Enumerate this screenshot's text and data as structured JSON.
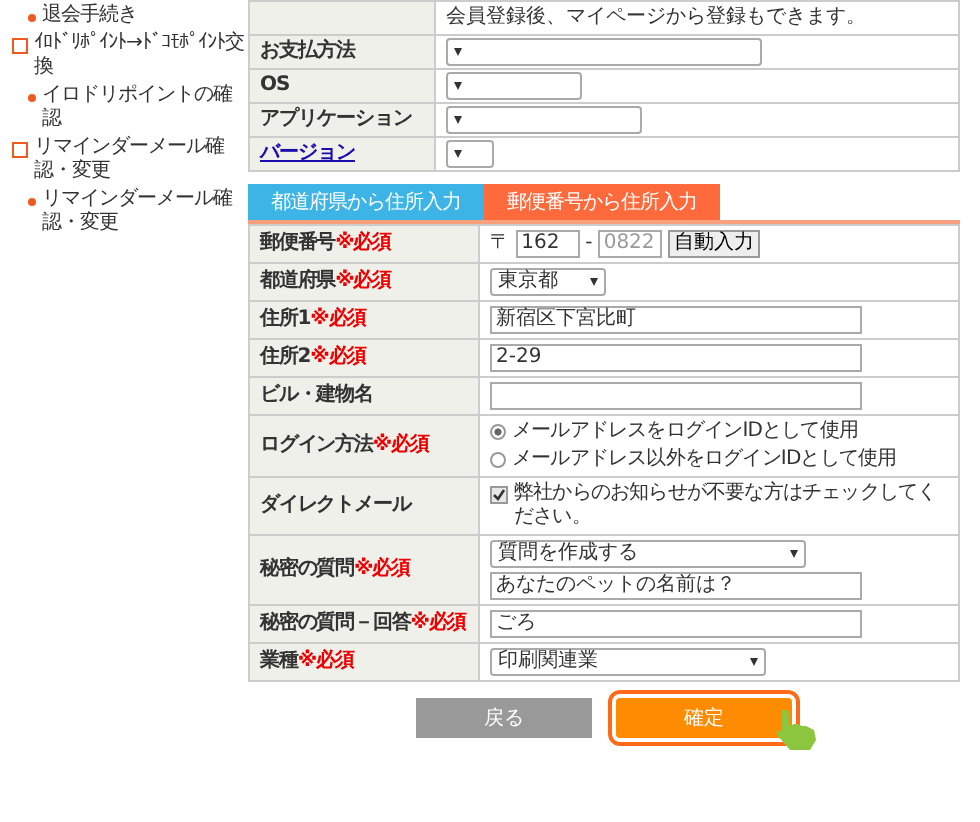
{
  "sidebar": [
    {
      "kind": "item",
      "label": "退会手続き"
    },
    {
      "kind": "section",
      "label": "ｲﾛﾄﾞﾘﾎﾟｲﾝﾄ→ﾄﾞｺﾓﾎﾟｲﾝﾄ交換"
    },
    {
      "kind": "item",
      "label": "イロドリポイントの確認"
    },
    {
      "kind": "section",
      "label": "リマインダーメール確認・変更"
    },
    {
      "kind": "item",
      "label": "リマインダーメール確認・変更"
    }
  ],
  "top_form": {
    "rows": [
      {
        "kind": "note",
        "value": "会員登録後、マイページから登録もできます。"
      },
      {
        "kind": "select",
        "label": "お支払方法",
        "link": false
      },
      {
        "kind": "select",
        "label": "OS",
        "link": false
      },
      {
        "kind": "select",
        "label": "アプリケーション",
        "link": false
      },
      {
        "kind": "select",
        "label": "バージョン",
        "link": true
      }
    ]
  },
  "tabs": [
    {
      "label": "都道府県から住所入力",
      "selected": false
    },
    {
      "label": "郵便番号から住所入力",
      "selected": true
    }
  ],
  "address_form": {
    "rows": [
      {
        "kind": "postal",
        "label": "郵便番号",
        "required": "※必須",
        "prefix": "〒",
        "first": "162",
        "separator": "-",
        "second": "0822",
        "button": "自動入力"
      },
      {
        "kind": "select",
        "label": "都道府県",
        "required": "※必須",
        "value": "東京都"
      },
      {
        "kind": "input",
        "label": "住所1",
        "required": "※必須",
        "value": "新宿区下宮比町"
      },
      {
        "kind": "input",
        "label": "住所2",
        "required": "※必須",
        "value": "2-29"
      },
      {
        "kind": "input",
        "label": "ビル・建物名"
      },
      {
        "kind": "radio",
        "label": "ログイン方法",
        "required": "※必須",
        "options": [
          {
            "label": "メールアドレスをログインIDとして使用",
            "selected": true
          },
          {
            "label": "メールアドレス以外をログインIDとして使用",
            "selected": false
          }
        ]
      },
      {
        "kind": "checkbox",
        "label": "ダイレクトメール",
        "text": "弊社からのお知らせが不要な方はチェックしてください。",
        "checked": true
      },
      {
        "kind": "select_input",
        "label": "秘密の質問",
        "required": "※必須",
        "value": "質問を作成する",
        "input": "あなたのペットの名前は？"
      },
      {
        "kind": "input",
        "label": "秘密の質問－回答",
        "required": "※必須",
        "value": "ごろ"
      },
      {
        "kind": "select",
        "label": "業種",
        "required": "※必須",
        "value": "印刷関連業"
      }
    ]
  },
  "buttons": [
    {
      "kind": "back",
      "label": "戻る",
      "focused": false
    },
    {
      "kind": "confirm",
      "label": "確定",
      "focused": true
    }
  ]
}
